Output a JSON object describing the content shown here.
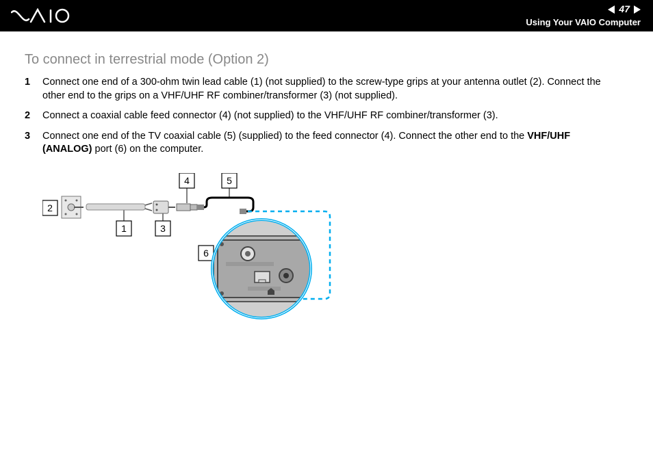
{
  "header": {
    "page_number": "47",
    "section_title": "Using Your VAIO Computer",
    "logo_alt": "VAIO"
  },
  "page": {
    "heading": "To connect in terrestrial mode (Option 2)",
    "steps": [
      {
        "text_before": "Connect one end of a 300-ohm twin lead cable (1) (not supplied) to the screw-type grips at your antenna outlet (2). Connect the other end to the grips on a VHF/UHF RF combiner/transformer (3) (not supplied).",
        "bold": "",
        "text_after": ""
      },
      {
        "text_before": "Connect a coaxial cable feed connector (4) (not supplied) to the VHF/UHF RF combiner/transformer (3).",
        "bold": "",
        "text_after": ""
      },
      {
        "text_before": "Connect one end of the TV coaxial cable (5) (supplied) to the feed connector (4). Connect the other end to the ",
        "bold": "VHF/UHF (ANALOG)",
        "text_after": " port (6) on the computer."
      }
    ]
  },
  "diagram": {
    "labels": {
      "1": "1",
      "2": "2",
      "3": "3",
      "4": "4",
      "5": "5",
      "6": "6"
    }
  }
}
